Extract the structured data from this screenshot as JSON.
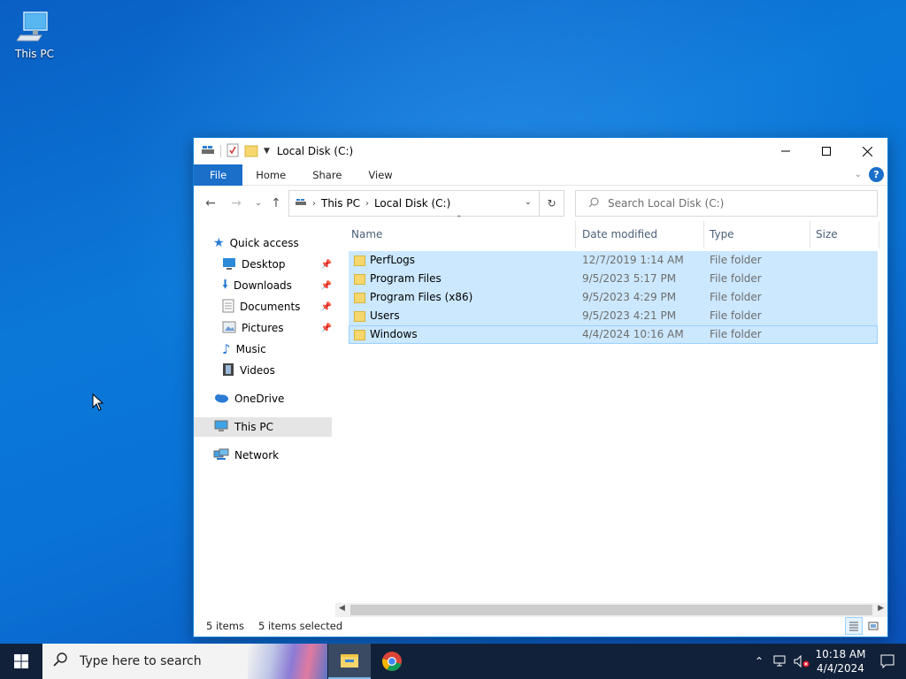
{
  "desktop": {
    "icons": [
      {
        "label": "This PC",
        "icon": "this-pc-icon"
      }
    ]
  },
  "window": {
    "title": "Local Disk (C:)",
    "controls": {
      "minimize": "minimize",
      "maximize": "maximize",
      "close": "close"
    },
    "ribbon_tabs": [
      "File",
      "Home",
      "Share",
      "View"
    ],
    "address": {
      "segments": [
        "This PC",
        "Local Disk (C:)"
      ]
    },
    "search": {
      "placeholder": "Search Local Disk (C:)"
    },
    "nav_pane": {
      "quick_access": "Quick access",
      "quick_items": [
        {
          "label": "Desktop",
          "pinned": true,
          "icon": "desktop-icon"
        },
        {
          "label": "Downloads",
          "pinned": true,
          "icon": "downloads-icon"
        },
        {
          "label": "Documents",
          "pinned": true,
          "icon": "documents-icon"
        },
        {
          "label": "Pictures",
          "pinned": true,
          "icon": "pictures-icon"
        },
        {
          "label": "Music",
          "pinned": false,
          "icon": "music-icon"
        },
        {
          "label": "Videos",
          "pinned": false,
          "icon": "videos-icon"
        }
      ],
      "onedrive": "OneDrive",
      "this_pc": "This PC",
      "network": "Network"
    },
    "columns": [
      "Name",
      "Date modified",
      "Type",
      "Size"
    ],
    "files": [
      {
        "name": "PerfLogs",
        "date": "12/7/2019 1:14 AM",
        "type": "File folder",
        "size": ""
      },
      {
        "name": "Program Files",
        "date": "9/5/2023 5:17 PM",
        "type": "File folder",
        "size": ""
      },
      {
        "name": "Program Files (x86)",
        "date": "9/5/2023 4:29 PM",
        "type": "File folder",
        "size": ""
      },
      {
        "name": "Users",
        "date": "9/5/2023 4:21 PM",
        "type": "File folder",
        "size": ""
      },
      {
        "name": "Windows",
        "date": "4/4/2024 10:16 AM",
        "type": "File folder",
        "size": ""
      }
    ],
    "status": {
      "items": "5 items",
      "selected": "5 items selected"
    }
  },
  "taskbar": {
    "search_placeholder": "Type here to search",
    "apps": [
      {
        "name": "File Explorer",
        "icon": "file-explorer-icon",
        "active": true
      },
      {
        "name": "Google Chrome",
        "icon": "chrome-icon",
        "active": false
      }
    ],
    "clock": {
      "time": "10:18 AM",
      "date": "4/4/2024"
    }
  },
  "colors": {
    "accent": "#1a6fc9",
    "selection": "#cce8ff",
    "taskbar": "#12213a",
    "folder": "#f5d76e"
  }
}
